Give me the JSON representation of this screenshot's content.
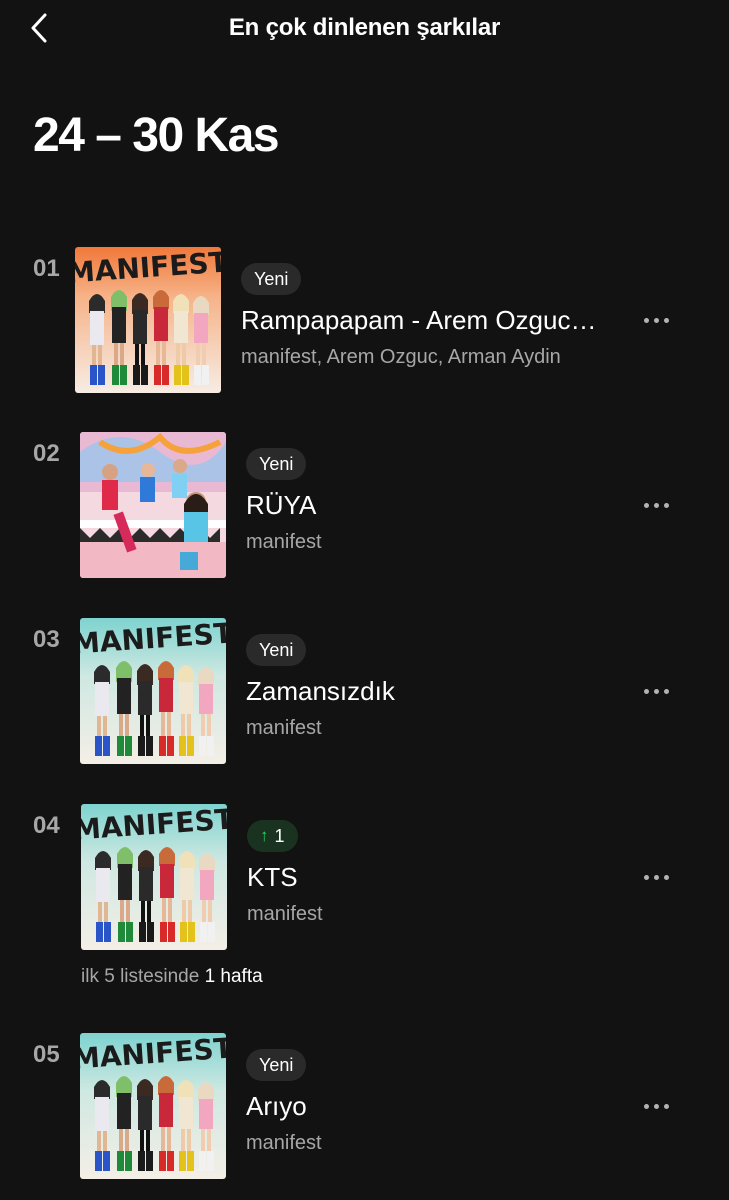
{
  "header": {
    "back_icon": "chevron-left-icon",
    "title": "En çok dinlenen şarkılar"
  },
  "week_range": "24 – 30 Kas",
  "tracks": [
    {
      "rank": "01",
      "badge": "Yeni",
      "title": "Rampapapam - Arem Ozguc…",
      "artists": "manifest, Arem Ozguc, Arman Aydin",
      "cover": "manifest-album-orange"
    },
    {
      "rank": "02",
      "badge": "Yeni",
      "title": "RÜYA",
      "artists": "manifest",
      "cover": "ruya-single-pink"
    },
    {
      "rank": "03",
      "badge": "Yeni",
      "title": "Zamansızdık",
      "artists": "manifest",
      "cover": "manifest-album-teal"
    },
    {
      "rank": "04",
      "badge": "1",
      "badge_icon": "arrow-up-icon",
      "title": "KTS",
      "artists": "manifest",
      "cover": "manifest-album-teal",
      "weeks_note_prefix": "ilk 5 listesinde",
      "weeks_note_value": "1 hafta"
    },
    {
      "rank": "05",
      "badge": "Yeni",
      "title": "Arıyo",
      "artists": "manifest",
      "cover": "manifest-album-teal"
    }
  ],
  "colors": {
    "background": "#121212",
    "text_secondary": "#a7a7a7",
    "badge_bg": "#2a2a2a",
    "up_green": "#1ed760"
  }
}
